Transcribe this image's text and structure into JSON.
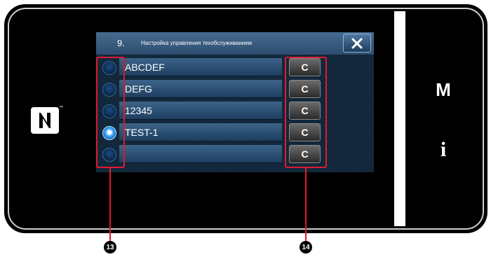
{
  "screen": {
    "side_buttons": {
      "m_label": "M",
      "i_label": "i"
    }
  },
  "dialog": {
    "title_number": "9.",
    "title_text": "Настройка управления техобслуживанием",
    "close_icon": "close-icon",
    "rows": [
      {
        "name": "ABCDEF",
        "selected": false,
        "clear_label": "C"
      },
      {
        "name": "DEFG",
        "selected": false,
        "clear_label": "C"
      },
      {
        "name": "12345",
        "selected": false,
        "clear_label": "C"
      },
      {
        "name": "TEST-1",
        "selected": true,
        "clear_label": "C"
      },
      {
        "name": "",
        "selected": false,
        "clear_label": "C"
      }
    ]
  },
  "callouts": {
    "radio_group": "13",
    "clear_buttons": "14"
  },
  "colors": {
    "accent": "#e0192e",
    "title_bar": "#3a5f82",
    "dialog_bg": "#0e2438"
  }
}
